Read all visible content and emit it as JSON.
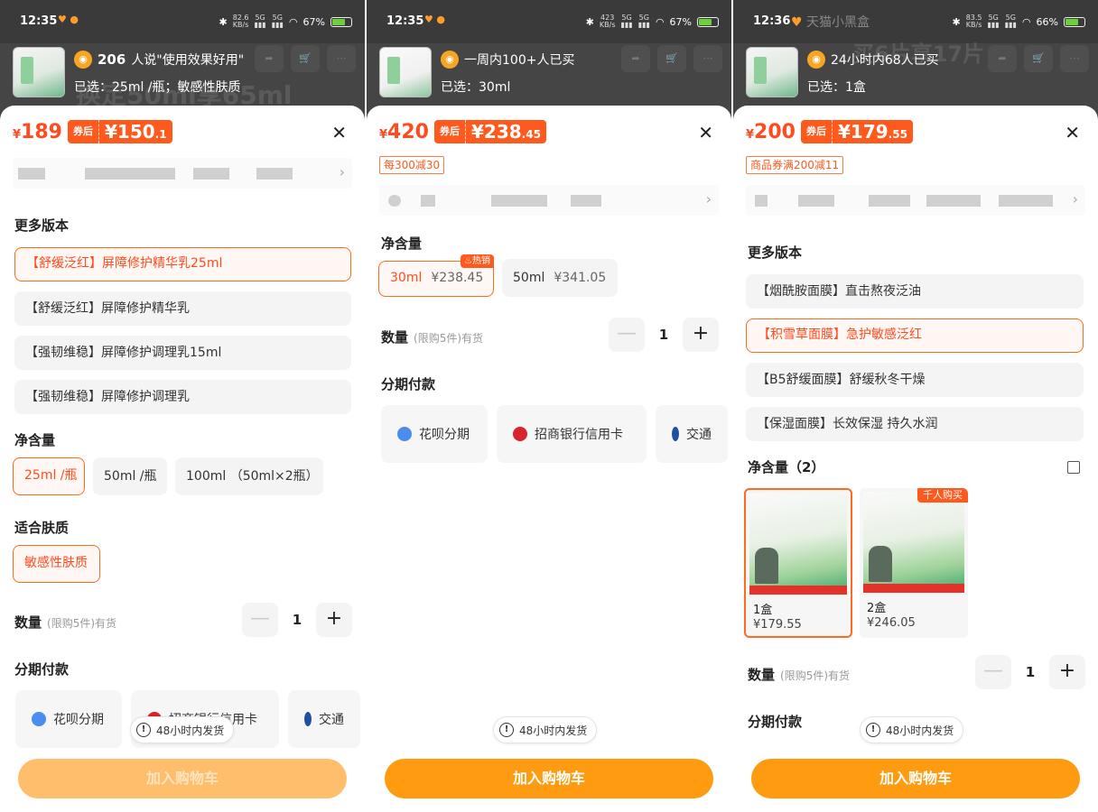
{
  "status": {
    "screen1": {
      "time": "12:35",
      "battery": "67%",
      "net": "82.6"
    },
    "screen2": {
      "time": "12:35",
      "battery": "67%",
      "net": "423"
    },
    "screen3": {
      "time": "12:36",
      "battery": "66%",
      "net": "83.5"
    }
  },
  "screen1": {
    "social_count": "206",
    "social_text": "人说\"使用效果好用\"",
    "selected": "已选：25ml /瓶；敏感性肤质",
    "price_symbol": "¥",
    "price": "189",
    "coupon_label": "券后",
    "coupon_price_int": "¥150",
    "coupon_price_dec": ".1",
    "versions_title": "更多版本",
    "versions": [
      "【舒缓泛红】屏障修护精华乳25ml",
      "【舒缓泛红】屏障修护精华乳",
      "【强韧维稳】屏障修护调理乳15ml",
      "【强韧维稳】屏障修护调理乳"
    ],
    "volume_title": "净含量",
    "volumes": [
      "25ml /瓶",
      "50ml /瓶",
      "100ml （50ml×2瓶）"
    ],
    "skin_title": "适合肤质",
    "skin": "敏感性肤质",
    "qty_title": "数量",
    "qty_note": "(限购5件)有货",
    "qty": "1",
    "pay_title": "分期付款",
    "pay_options": [
      "花呗分期",
      "招商银行信用卡",
      "交通"
    ],
    "ship_tip": "48小时内发货",
    "cart_button": "加入购物车"
  },
  "screen2": {
    "social_text": "一周内100+人已买",
    "selected": "已选：30ml",
    "price_symbol": "¥",
    "price": "420",
    "coupon_label": "券后",
    "coupon_price_int": "¥238",
    "coupon_price_dec": ".45",
    "promo": "每300减30",
    "volume_title": "净含量",
    "volumes": [
      {
        "name": "30ml",
        "price": "¥238.45",
        "badge": "热销"
      },
      {
        "name": "50ml",
        "price": "¥341.05"
      }
    ],
    "qty_title": "数量",
    "qty_note": "(限购5件)有货",
    "qty": "1",
    "pay_title": "分期付款",
    "pay_options": [
      "花呗分期",
      "招商银行信用卡",
      "交通"
    ],
    "ship_tip": "48小时内发货",
    "cart_button": "加入购物车"
  },
  "screen3": {
    "social_text": "24小时内68人已买",
    "selected": "已选：1盒",
    "price_symbol": "¥",
    "price": "200",
    "coupon_label": "券后",
    "coupon_price_int": "¥179",
    "coupon_price_dec": ".55",
    "promo": "商品券满200减11",
    "versions_title": "更多版本",
    "versions": [
      "【烟酰胺面膜】直击熬夜泛油",
      "【积雪草面膜】急护敏感泛红",
      "【B5舒缓面膜】舒缓秋冬干燥",
      "【保湿面膜】长效保湿 持久水润"
    ],
    "volume_title": "净含量（2）",
    "products": [
      {
        "name": "1盒",
        "price": "¥179.55"
      },
      {
        "name": "2盒",
        "price": "¥246.05",
        "badge": "千人购买"
      }
    ],
    "qty_title": "数量",
    "qty_note": "(限购5件)有货",
    "qty": "1",
    "pay_title": "分期付款",
    "ship_tip": "48小时内发货",
    "cart_button": "加入购物车"
  },
  "backdrop_text": {
    "s1": "换定50ml享65ml",
    "s3": "买6片享17片"
  },
  "backdrop_brand": "天猫小黑盒",
  "icons": [
    "close-icon",
    "chevron-right-icon",
    "fire-icon",
    "info-icon",
    "grid-icon",
    "minus-icon",
    "plus-icon"
  ],
  "colors": {
    "accent": "#ff5a1e",
    "cart": "#ff9b10",
    "selected_border": "#ff6a1e"
  }
}
